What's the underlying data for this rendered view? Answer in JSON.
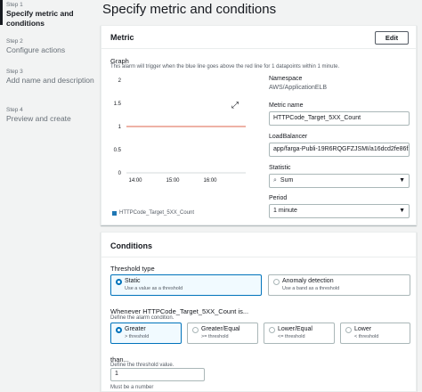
{
  "sidebar": {
    "steps": [
      {
        "num": "Step 1",
        "label": "Specify metric and conditions"
      },
      {
        "num": "Step 2",
        "label": "Configure actions"
      },
      {
        "num": "Step 3",
        "label": "Add name and description"
      },
      {
        "num": "Step 4",
        "label": "Preview and create"
      }
    ]
  },
  "page": {
    "title": "Specify metric and conditions"
  },
  "metric": {
    "title": "Metric",
    "edit_label": "Edit",
    "graph_label": "Graph",
    "graph_desc": "This alarm will trigger when the blue line goes above the red line for 1 datapoints within 1 minute.",
    "namespace_label": "Namespace",
    "namespace_value": "AWS/ApplicationELB",
    "metric_name_label": "Metric name",
    "metric_name_value": "HTTPCode_Target_5XX_Count",
    "loadbalancer_label": "LoadBalancer",
    "loadbalancer_value": "app/farga-Publi-19R6RQGFZJSMI/a16dcd2fe86f2f",
    "statistic_label": "Statistic",
    "statistic_value": "Sum",
    "period_label": "Period",
    "period_value": "1 minute"
  },
  "chart_data": {
    "type": "line",
    "y_ticks": [
      "2",
      "1.5",
      "1",
      "0.5",
      "0"
    ],
    "x_ticks": [
      "14:00",
      "15:00",
      "16:00"
    ],
    "ylim": [
      0,
      2
    ],
    "threshold": 1,
    "threshold_color": "#d13212",
    "series": [
      {
        "name": "HTTPCode_Target_5XX_Count",
        "color": "#1f77b4",
        "values": []
      }
    ]
  },
  "conditions": {
    "title": "Conditions",
    "threshold_type_label": "Threshold type",
    "threshold_types": [
      {
        "label": "Static",
        "desc": "Use a value as a threshold",
        "selected": true
      },
      {
        "label": "Anomaly detection",
        "desc": "Use a band as a threshold",
        "selected": false
      }
    ],
    "whenever_label": "Whenever HTTPCode_Target_5XX_Count is...",
    "whenever_desc": "Define the alarm condition.",
    "operators": [
      {
        "label": "Greater",
        "desc": "> threshold",
        "selected": true
      },
      {
        "label": "Greater/Equal",
        "desc": ">= threshold",
        "selected": false
      },
      {
        "label": "Lower/Equal",
        "desc": "<= threshold",
        "selected": false
      },
      {
        "label": "Lower",
        "desc": "< threshold",
        "selected": false
      }
    ],
    "than_label": "than...",
    "than_desc": "Define the threshold value.",
    "threshold_value": "1",
    "threshold_hint": "Must be a number"
  },
  "colors": {
    "accent": "#0073bb",
    "threshold_line": "#d13212",
    "series": "#1f77b4"
  }
}
